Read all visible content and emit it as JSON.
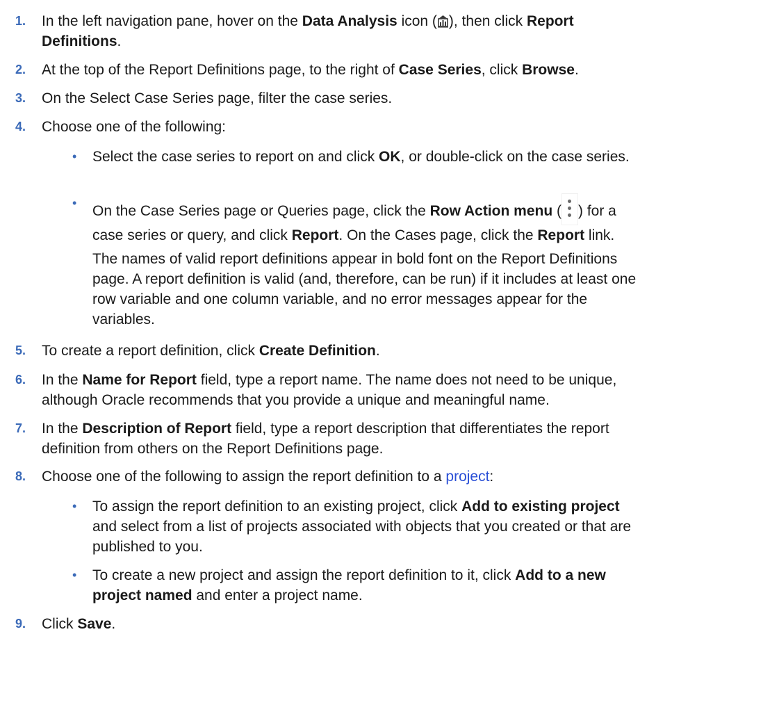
{
  "steps": [
    {
      "num": "1.",
      "a": "In the left navigation pane, hover on the ",
      "b1": "Data Analysis",
      "c": " icon (",
      "d": "), then click ",
      "b2": "Report",
      "b3": "Definitions",
      "e": "."
    },
    {
      "num": "2.",
      "a": "At the top of the Report Definitions page, to the right of ",
      "b1": "Case Series",
      "c": ", click ",
      "b2": "Browse",
      "e": "."
    },
    {
      "num": "3.",
      "a": "On the Select Case Series page, filter the case series."
    },
    {
      "num": "4.",
      "a": "Choose one of the following:"
    },
    {
      "num": "5.",
      "a": "To create a report definition, click ",
      "b1": "Create Definition",
      "e": "."
    },
    {
      "num": "6.",
      "a": "In the ",
      "b1": "Name for Report",
      "c": " field, type a report name. The name does not need to be unique,",
      "d": "although Oracle recommends that you provide a unique and meaningful name."
    },
    {
      "num": "7.",
      "a": "In the ",
      "b1": "Description of Report",
      "c": " field, type a report description that differentiates the report",
      "d": "definition from others on the Report Definitions page."
    },
    {
      "num": "8.",
      "a": "Choose one of the following to assign the report definition to a ",
      "link": "project",
      "e": ":"
    },
    {
      "num": "9.",
      "a": "Click ",
      "b1": "Save",
      "e": "."
    }
  ],
  "step4": {
    "bullet": "•",
    "b1_a": "Select the case series to report on and click ",
    "b1_b": "OK",
    "b1_c": ", or double-click on the case series.",
    "b2_a": "On the Case Series page or Queries page, click the ",
    "b2_b": "Row Action menu",
    "b2_c": " (",
    "b2_d": ") for a",
    "b2_e": "case series or query, and click ",
    "b2_f": "Report",
    "b2_g": ". On the Cases page, click the ",
    "b2_h": "Report",
    "b2_i": " link.",
    "para_1": "The names of valid report definitions appear in bold font on the Report Definitions",
    "para_2": "page. A report definition is valid (and, therefore, can be run) if it includes at least one",
    "para_3": "row variable and one column variable, and no error messages appear for the",
    "para_4": "variables."
  },
  "step8": {
    "bullet": "•",
    "b1_a": "To assign the report definition to an existing project, click ",
    "b1_b": "Add to existing project",
    "b1_c": "and select from a list of projects associated with objects that you created or that are",
    "b1_d": "published to you.",
    "b2_a": "To create a new project and assign the report definition to it, click ",
    "b2_b": "Add to a new",
    "b2_c": "project named",
    "b2_d": " and enter a project name."
  },
  "icons": {
    "data_analysis": "data-analysis-icon",
    "row_action": "kebab-menu-icon"
  },
  "colors": {
    "step_number": "#3b6ab8",
    "link": "#2a4fd6"
  }
}
